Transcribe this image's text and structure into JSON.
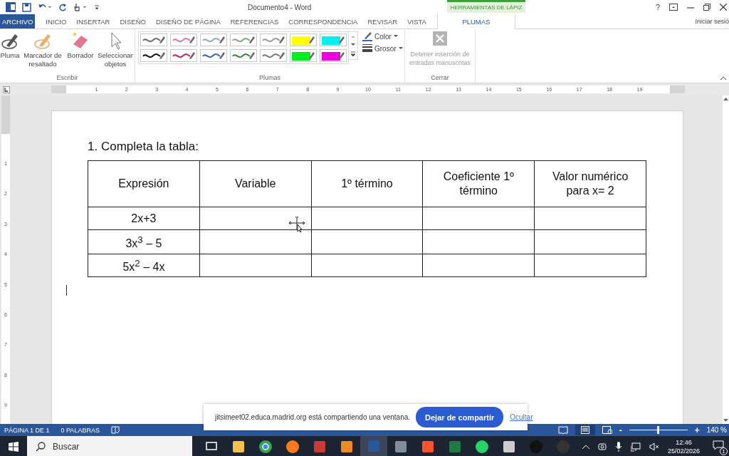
{
  "window": {
    "title": "Documento4 - Word",
    "context_group": "HERRAMIENTAS DE LÁPIZ",
    "help": "?",
    "signin": "Iniciar sesió"
  },
  "tabs": [
    {
      "label": "ARCHIVO",
      "kind": "file",
      "selected": false
    },
    {
      "label": "INICIO",
      "kind": "tab",
      "selected": false
    },
    {
      "label": "INSERTAR",
      "kind": "tab",
      "selected": false
    },
    {
      "label": "DISEÑO",
      "kind": "tab",
      "selected": false
    },
    {
      "label": "DISEÑO DE PÁGINA",
      "kind": "tab",
      "selected": false
    },
    {
      "label": "REFERENCIAS",
      "kind": "tab",
      "selected": false
    },
    {
      "label": "CORRESPONDENCIA",
      "kind": "tab",
      "selected": false
    },
    {
      "label": "REVISAR",
      "kind": "tab",
      "selected": false
    },
    {
      "label": "VISTA",
      "kind": "tab",
      "selected": false
    },
    {
      "label": "PLUMAS",
      "kind": "context",
      "selected": true
    }
  ],
  "ribbon": {
    "escribir": {
      "label": "Escribir",
      "tools": [
        {
          "label": "Pluma",
          "kind": "pen"
        },
        {
          "label": "Marcador de resaltado",
          "kind": "highlighter"
        },
        {
          "label": "Borrador",
          "kind": "eraser"
        },
        {
          "label": "Seleccionar objetos",
          "kind": "select"
        }
      ]
    },
    "plumas": {
      "label": "Plumas",
      "pens": [
        {
          "kind": "pen",
          "color": "#6d6d6d"
        },
        {
          "kind": "pen",
          "color": "#e07a9a"
        },
        {
          "kind": "pen",
          "color": "#8fa8c8"
        },
        {
          "kind": "pen",
          "color": "#8aa08a"
        },
        {
          "kind": "pen",
          "color": "#9a9a9a"
        },
        {
          "kind": "highlighter",
          "color": "#ffff00"
        },
        {
          "kind": "highlighter",
          "color": "#00f0f0"
        },
        {
          "kind": "pen",
          "color": "#111111"
        },
        {
          "kind": "pen",
          "color": "#d0245a"
        },
        {
          "kind": "pen",
          "color": "#3a66b8"
        },
        {
          "kind": "pen",
          "color": "#2f8a3c"
        },
        {
          "kind": "pen",
          "color": "#7a7a7a"
        },
        {
          "kind": "highlighter",
          "color": "#00ee22"
        },
        {
          "kind": "highlighter",
          "color": "#ee00dd"
        }
      ],
      "dropdowns": [
        {
          "label": "Color",
          "kind": "ink"
        },
        {
          "label": "Grosor",
          "kind": "weight"
        }
      ]
    },
    "cerrar": {
      "label": "Cerrar",
      "button": "Detener inserción de entradas manuscritas",
      "disabled": true
    }
  },
  "ruler": [
    "1",
    "2",
    "3",
    "4",
    "5",
    "6",
    "7",
    "8",
    "9",
    "10",
    "11",
    "12",
    "13",
    "14",
    "15",
    "16",
    "17",
    "18",
    "19"
  ],
  "vertical_ruler": [
    "1",
    "2",
    "3",
    "4",
    "5",
    "6",
    "7",
    "8",
    "9"
  ],
  "document": {
    "heading": "1. Completa la tabla:",
    "table": {
      "columns": [
        "Expresión",
        "Variable",
        "1º término",
        "Coeficiente 1º término",
        "Valor numérico para x= 2"
      ],
      "rows": [
        [
          "2x+3",
          "",
          "",
          "",
          ""
        ],
        [
          "3x$^{3}$ – 5",
          "",
          "",
          "",
          ""
        ],
        [
          "5x$^{2}$ – 4x",
          "",
          "",
          "",
          ""
        ]
      ]
    }
  },
  "share_bar": {
    "message": "jitsimeet02.educa.madrid.org está compartiendo una ventana.",
    "button": "Dejar de compartir",
    "link": "Ocultar"
  },
  "status_bar": {
    "page": "PÁGINA 1 DE 1",
    "words": "0 PALABRAS",
    "zoom": "140 %",
    "zoom_out": "-",
    "zoom_in": "+",
    "zoom_slider": {
      "level": 0.49
    }
  },
  "taskbar": {
    "search": {
      "placeholder": "Buscar"
    },
    "apps": [
      {
        "selected": false
      },
      {
        "selected": false
      },
      {
        "selected": false
      },
      {
        "selected": false
      },
      {
        "selected": false
      },
      {
        "selected": false
      },
      {
        "selected": true
      },
      {
        "selected": false
      },
      {
        "selected": false
      },
      {
        "selected": false
      },
      {
        "selected": false
      },
      {
        "selected": false
      },
      {
        "selected": false
      },
      {
        "selected": false
      }
    ],
    "time": "12:46",
    "date": "25/02/2026",
    "notifications": "1"
  }
}
